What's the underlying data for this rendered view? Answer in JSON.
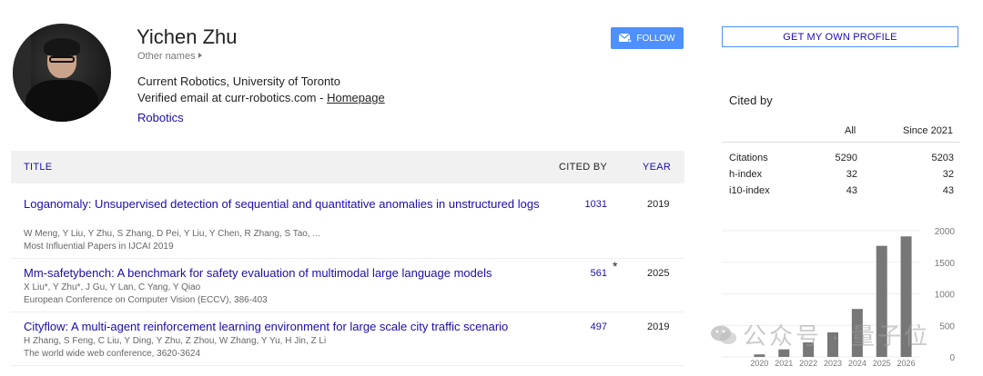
{
  "profile": {
    "name": "Yichen Zhu",
    "other_names": "Other names",
    "affiliation": "Current Robotics, University of Toronto",
    "email_prefix": "Verified email at curr-robotics.com - ",
    "homepage": "Homepage",
    "interest": "Robotics"
  },
  "follow_label": "FOLLOW",
  "own_profile_label": "GET MY OWN PROFILE",
  "table": {
    "col_title": "TITLE",
    "col_cited": "CITED BY",
    "col_year": "YEAR",
    "rows": [
      {
        "title": "Loganomaly: Unsupervised detection of sequential and quantitative anomalies in unstructured logs",
        "authors": "W Meng, Y Liu, Y Zhu, S Zhang, D Pei, Y Liu, Y Chen, R Zhang, S Tao, ...",
        "venue": "Most Influential Papers in IJCAI 2019",
        "cited": "1031",
        "year": "2019"
      },
      {
        "title": "Mm-safetybench: A benchmark for safety evaluation of multimodal large language models",
        "authors": "X Liu*, Y Zhu*, J Gu, Y Lan, C Yang, Y Qiao",
        "venue": "European Conference on Computer Vision (ECCV), 386-403",
        "cited": "561",
        "star": "*",
        "year": "2025"
      },
      {
        "title": "Cityflow: A multi-agent reinforcement learning environment for large scale city traffic scenario",
        "authors": "H Zhang, S Feng, C Liu, Y Ding, Y Zhu, Z Zhou, W Zhang, Y Yu, H Jin, Z Li",
        "venue": "The world wide web conference, 3620-3624",
        "cited": "497",
        "year": "2019"
      }
    ]
  },
  "cited_by": {
    "title": "Cited by",
    "col_all": "All",
    "col_since": "Since 2021",
    "metrics": [
      {
        "label": "Citations",
        "all": "5290",
        "since": "5203"
      },
      {
        "label": "h-index",
        "all": "32",
        "since": "32"
      },
      {
        "label": "i10-index",
        "all": "43",
        "since": "43"
      }
    ]
  },
  "chart_data": {
    "type": "bar",
    "categories": [
      "2020",
      "2021",
      "2022",
      "2023",
      "2024",
      "2025",
      "2026"
    ],
    "values": [
      40,
      120,
      230,
      390,
      760,
      1760,
      1910
    ],
    "yticks": [
      "2000",
      "1500",
      "1000",
      "500",
      "0"
    ],
    "ylim": [
      0,
      2000
    ],
    "color": "#777777"
  },
  "watermark": "公众号 · 量子位"
}
